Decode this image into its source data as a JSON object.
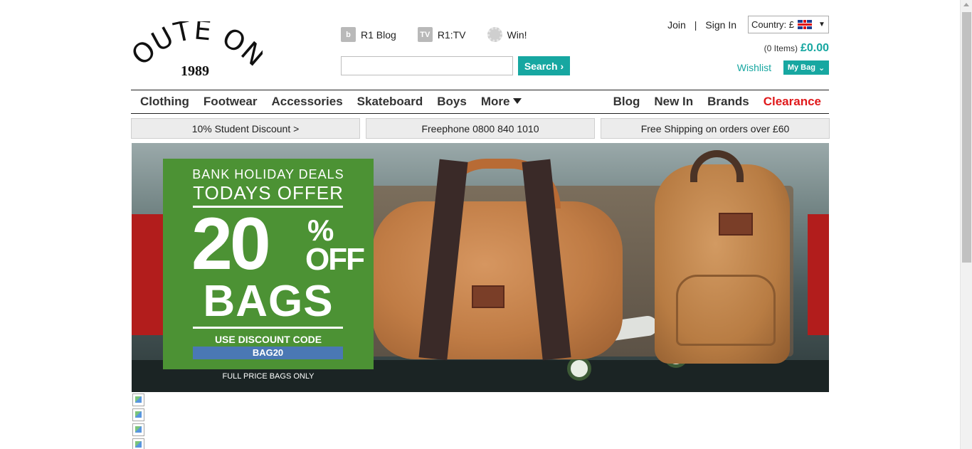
{
  "brand": {
    "name_line1": "ROUTE ONE",
    "name_line2": "1989"
  },
  "top_links": [
    {
      "icon": "blog-icon",
      "glyph": "b",
      "label": "R1 Blog"
    },
    {
      "icon": "tv-icon",
      "glyph": "TV",
      "label": "R1:TV"
    },
    {
      "icon": "win-icon",
      "glyph": "",
      "label": "Win!"
    }
  ],
  "search": {
    "placeholder": "",
    "button_label": "Search",
    "button_chevron": "›"
  },
  "account": {
    "join": "Join",
    "separator": "|",
    "sign_in": "Sign In",
    "country_label": "Country: £",
    "country_chevron": "▼"
  },
  "bag": {
    "items_text": "(0 Items)",
    "total": "£0.00",
    "wishlist": "Wishlist",
    "my_bag": "My Bag",
    "my_bag_chevron": "⌄"
  },
  "nav": {
    "left": [
      "Clothing",
      "Footwear",
      "Accessories",
      "Skateboard",
      "Boys",
      "More"
    ],
    "right": [
      "Blog",
      "New In",
      "Brands",
      "Clearance"
    ]
  },
  "promos": [
    "10% Student Discount >",
    "Freephone 0800 840 1010",
    "Free Shipping on orders over £60"
  ],
  "banner": {
    "line1": "BANK HOLIDAY DEALS",
    "line2": "TODAYS OFFER",
    "amount": "20",
    "percent": "%",
    "off": "OFF",
    "product": "BAGS",
    "use_code": "USE DISCOUNT CODE",
    "code": "BAG20",
    "fineprint": "FULL PRICE BAGS ONLY"
  },
  "colors": {
    "accent": "#17a7a1",
    "clearance": "#e0191b",
    "offer_green": "#4c9234",
    "code_blue": "#4a78b4"
  }
}
